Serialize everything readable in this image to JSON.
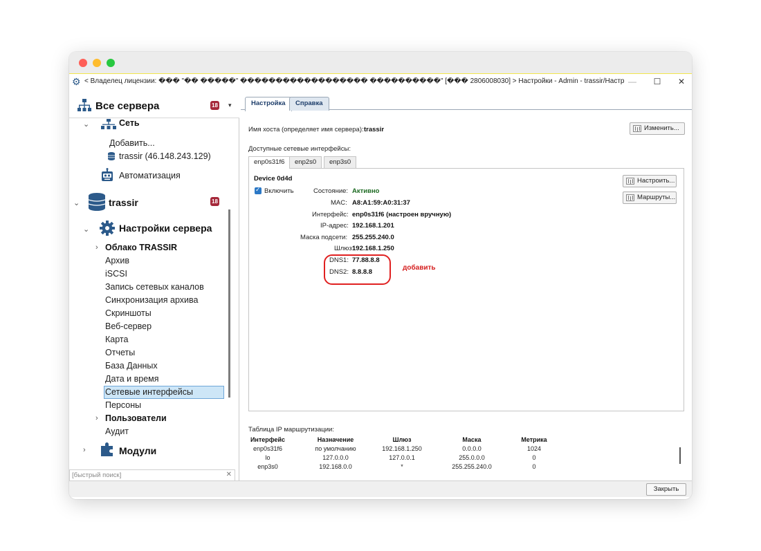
{
  "window": {
    "title": "< Владелец лицензии: ��� \"�� �����\" ������������������ ����������\" [��� 2806008030] > Настройки - Admin - trassir/Настройки сервера...",
    "controls": {
      "minimize": "—",
      "maximize": "☐",
      "close": "✕"
    }
  },
  "tree": {
    "header_title": "Все сервера",
    "header_badge": "18",
    "items": {
      "network": "Сеть",
      "add": "Добавить...",
      "trassir_ip": "trassir (46.148.243.129)",
      "automation": "Автоматизация",
      "trassir": "trassir",
      "trassir_badge": "18",
      "server_settings": "Настройки сервера",
      "cloud": "Облако TRASSIR",
      "archive": "Архив",
      "iscsi": "iSCSI",
      "network_channels": "Запись сетевых каналов",
      "archive_sync": "Синхронизация архива",
      "screenshots": "Скриншоты",
      "web_server": "Веб-сервер",
      "map": "Карта",
      "reports": "Отчеты",
      "database": "База Данных",
      "datetime": "Дата и время",
      "net_interfaces": "Сетевые интерфейсы",
      "persons": "Персоны",
      "users": "Пользователи",
      "audit": "Аудит",
      "modules": "Модули"
    },
    "search_placeholder": "[быстрый поиск]"
  },
  "tabs": {
    "settings": "Настройка",
    "help": "Справка"
  },
  "hostname": {
    "label": "Имя хоста (определяет имя сервера):",
    "value": "trassir",
    "change_button": "Изменить..."
  },
  "interfaces": {
    "label": "Доступные сетевые интерфейсы:",
    "tabs": [
      "enp0s31f6",
      "enp2s0",
      "enp3s0"
    ],
    "device": "Device 0d4d",
    "enable_label": "Включить",
    "configure_button": "Настроить...",
    "routes_button": "Маршруты...",
    "fields": {
      "state_label": "Состояние:",
      "state_value": "Активно",
      "mac_label": "MAC:",
      "mac_value": "A8:A1:59:A0:31:37",
      "iface_label": "Интерфейс:",
      "iface_value": "enp0s31f6 (настроен вручную)",
      "ip_label": "IP-адрес:",
      "ip_value": "192.168.1.201",
      "mask_label": "Маска подсети:",
      "mask_value": "255.255.240.0",
      "gw_label": "Шлюз:",
      "gw_value": "192.168.1.250",
      "dns1_label": "DNS1:",
      "dns1_value": "77.88.8.8",
      "dns2_label": "DNS2:",
      "dns2_value": "8.8.8.8"
    },
    "annotation": "добавить"
  },
  "routes": {
    "title": "Таблица IP маршрутизации:",
    "headers": [
      "Интерфейс",
      "Назначение",
      "Шлюз",
      "Маска",
      "Метрика"
    ],
    "rows": [
      [
        "enp0s31f6",
        "по умолчанию",
        "192.168.1.250",
        "0.0.0.0",
        "1024"
      ],
      [
        "lo",
        "127.0.0.0",
        "127.0.0.1",
        "255.0.0.0",
        "0"
      ],
      [
        "enp3s0",
        "192.168.0.0",
        "*",
        "255.255.240.0",
        "0"
      ]
    ]
  },
  "footer": {
    "close_button": "Закрыть"
  },
  "colors": {
    "badge": "#a5283a",
    "active_status": "#1e6b23",
    "annotation": "#d52020",
    "selection": "#cde6f7"
  }
}
